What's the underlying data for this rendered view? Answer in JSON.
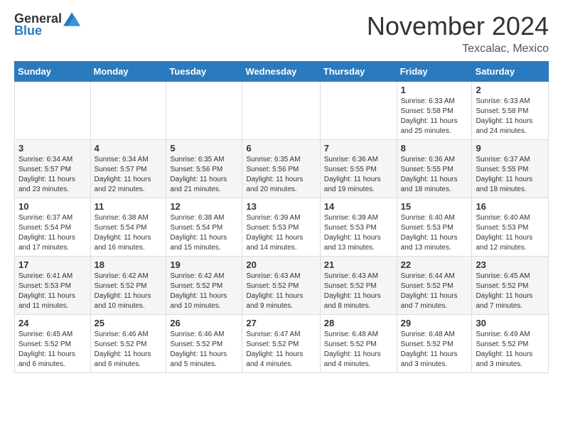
{
  "header": {
    "logo_general": "General",
    "logo_blue": "Blue",
    "month_title": "November 2024",
    "location": "Texcalac, Mexico"
  },
  "calendar": {
    "days_of_week": [
      "Sunday",
      "Monday",
      "Tuesday",
      "Wednesday",
      "Thursday",
      "Friday",
      "Saturday"
    ],
    "weeks": [
      [
        {
          "day": "",
          "info": ""
        },
        {
          "day": "",
          "info": ""
        },
        {
          "day": "",
          "info": ""
        },
        {
          "day": "",
          "info": ""
        },
        {
          "day": "",
          "info": ""
        },
        {
          "day": "1",
          "info": "Sunrise: 6:33 AM\nSunset: 5:58 PM\nDaylight: 11 hours and 25 minutes."
        },
        {
          "day": "2",
          "info": "Sunrise: 6:33 AM\nSunset: 5:58 PM\nDaylight: 11 hours and 24 minutes."
        }
      ],
      [
        {
          "day": "3",
          "info": "Sunrise: 6:34 AM\nSunset: 5:57 PM\nDaylight: 11 hours and 23 minutes."
        },
        {
          "day": "4",
          "info": "Sunrise: 6:34 AM\nSunset: 5:57 PM\nDaylight: 11 hours and 22 minutes."
        },
        {
          "day": "5",
          "info": "Sunrise: 6:35 AM\nSunset: 5:56 PM\nDaylight: 11 hours and 21 minutes."
        },
        {
          "day": "6",
          "info": "Sunrise: 6:35 AM\nSunset: 5:56 PM\nDaylight: 11 hours and 20 minutes."
        },
        {
          "day": "7",
          "info": "Sunrise: 6:36 AM\nSunset: 5:55 PM\nDaylight: 11 hours and 19 minutes."
        },
        {
          "day": "8",
          "info": "Sunrise: 6:36 AM\nSunset: 5:55 PM\nDaylight: 11 hours and 18 minutes."
        },
        {
          "day": "9",
          "info": "Sunrise: 6:37 AM\nSunset: 5:55 PM\nDaylight: 11 hours and 18 minutes."
        }
      ],
      [
        {
          "day": "10",
          "info": "Sunrise: 6:37 AM\nSunset: 5:54 PM\nDaylight: 11 hours and 17 minutes."
        },
        {
          "day": "11",
          "info": "Sunrise: 6:38 AM\nSunset: 5:54 PM\nDaylight: 11 hours and 16 minutes."
        },
        {
          "day": "12",
          "info": "Sunrise: 6:38 AM\nSunset: 5:54 PM\nDaylight: 11 hours and 15 minutes."
        },
        {
          "day": "13",
          "info": "Sunrise: 6:39 AM\nSunset: 5:53 PM\nDaylight: 11 hours and 14 minutes."
        },
        {
          "day": "14",
          "info": "Sunrise: 6:39 AM\nSunset: 5:53 PM\nDaylight: 11 hours and 13 minutes."
        },
        {
          "day": "15",
          "info": "Sunrise: 6:40 AM\nSunset: 5:53 PM\nDaylight: 11 hours and 13 minutes."
        },
        {
          "day": "16",
          "info": "Sunrise: 6:40 AM\nSunset: 5:53 PM\nDaylight: 11 hours and 12 minutes."
        }
      ],
      [
        {
          "day": "17",
          "info": "Sunrise: 6:41 AM\nSunset: 5:53 PM\nDaylight: 11 hours and 11 minutes."
        },
        {
          "day": "18",
          "info": "Sunrise: 6:42 AM\nSunset: 5:52 PM\nDaylight: 11 hours and 10 minutes."
        },
        {
          "day": "19",
          "info": "Sunrise: 6:42 AM\nSunset: 5:52 PM\nDaylight: 11 hours and 10 minutes."
        },
        {
          "day": "20",
          "info": "Sunrise: 6:43 AM\nSunset: 5:52 PM\nDaylight: 11 hours and 9 minutes."
        },
        {
          "day": "21",
          "info": "Sunrise: 6:43 AM\nSunset: 5:52 PM\nDaylight: 11 hours and 8 minutes."
        },
        {
          "day": "22",
          "info": "Sunrise: 6:44 AM\nSunset: 5:52 PM\nDaylight: 11 hours and 7 minutes."
        },
        {
          "day": "23",
          "info": "Sunrise: 6:45 AM\nSunset: 5:52 PM\nDaylight: 11 hours and 7 minutes."
        }
      ],
      [
        {
          "day": "24",
          "info": "Sunrise: 6:45 AM\nSunset: 5:52 PM\nDaylight: 11 hours and 6 minutes."
        },
        {
          "day": "25",
          "info": "Sunrise: 6:46 AM\nSunset: 5:52 PM\nDaylight: 11 hours and 6 minutes."
        },
        {
          "day": "26",
          "info": "Sunrise: 6:46 AM\nSunset: 5:52 PM\nDaylight: 11 hours and 5 minutes."
        },
        {
          "day": "27",
          "info": "Sunrise: 6:47 AM\nSunset: 5:52 PM\nDaylight: 11 hours and 4 minutes."
        },
        {
          "day": "28",
          "info": "Sunrise: 6:48 AM\nSunset: 5:52 PM\nDaylight: 11 hours and 4 minutes."
        },
        {
          "day": "29",
          "info": "Sunrise: 6:48 AM\nSunset: 5:52 PM\nDaylight: 11 hours and 3 minutes."
        },
        {
          "day": "30",
          "info": "Sunrise: 6:49 AM\nSunset: 5:52 PM\nDaylight: 11 hours and 3 minutes."
        }
      ]
    ]
  }
}
